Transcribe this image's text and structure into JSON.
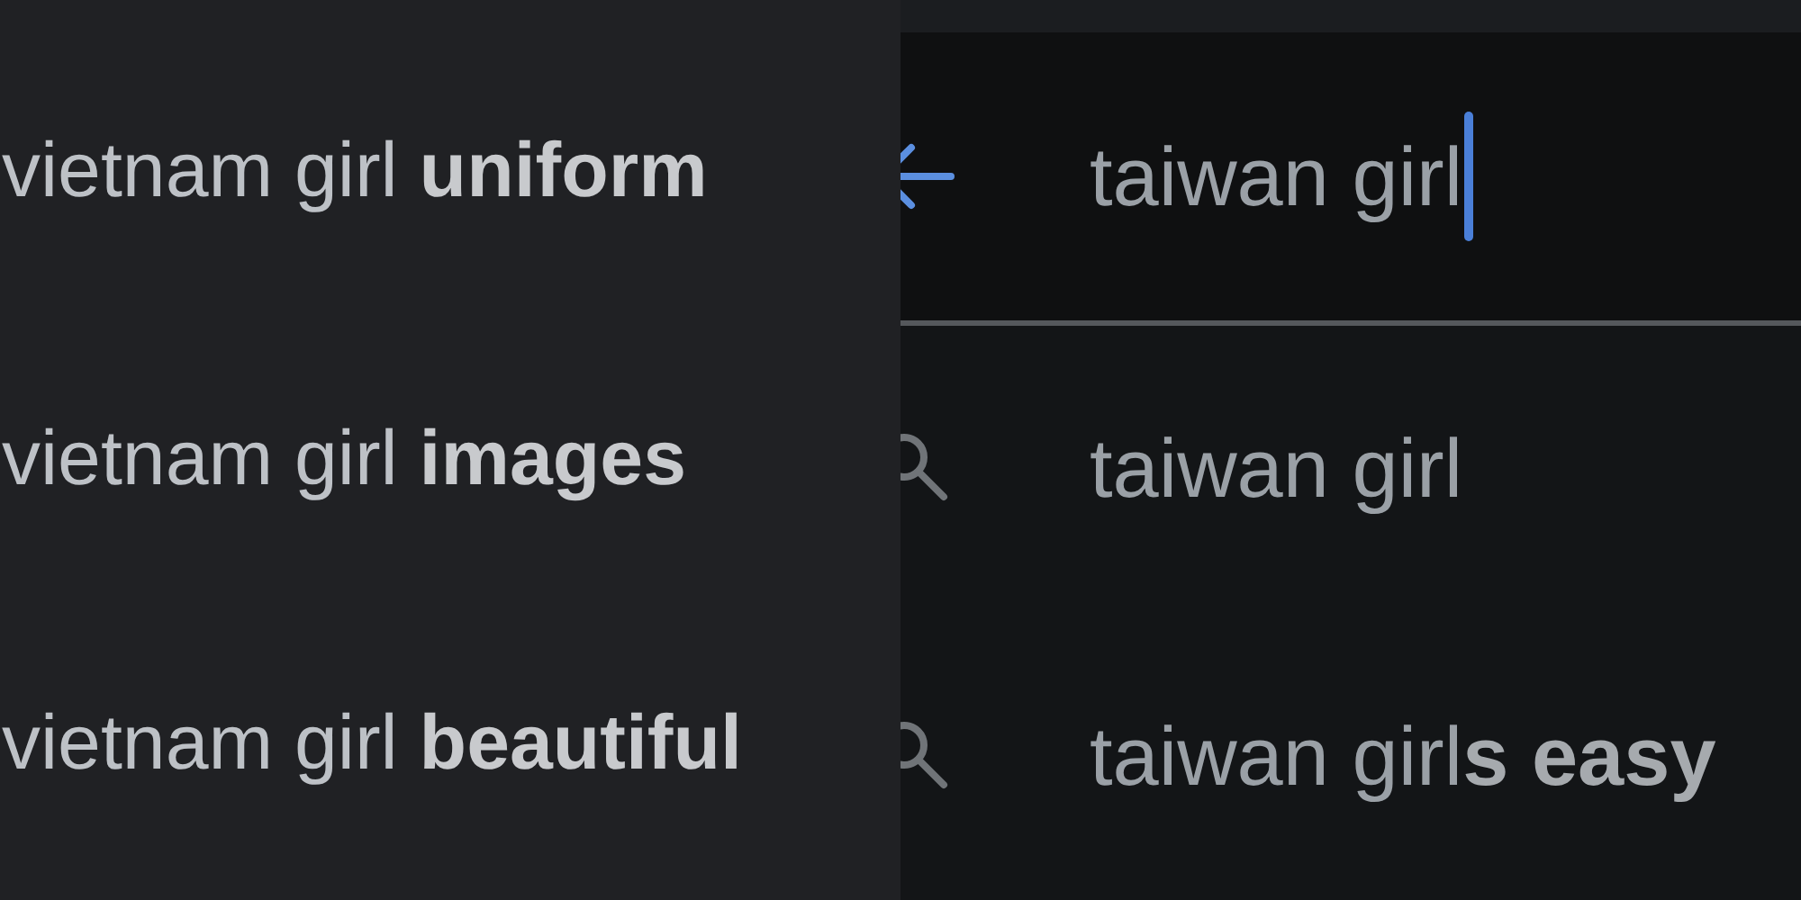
{
  "left_panel": {
    "suggestions": [
      {
        "text": "vietnam girl **uniform**"
      },
      {
        "text": "vietnam girl **images**"
      },
      {
        "text": "vietnam girl **beautiful**"
      }
    ]
  },
  "right_panel": {
    "search": {
      "value": "taiwan girl"
    },
    "suggestions": [
      {
        "text": "taiwan girl"
      },
      {
        "text": "taiwan girl**s easy**"
      }
    ]
  }
}
